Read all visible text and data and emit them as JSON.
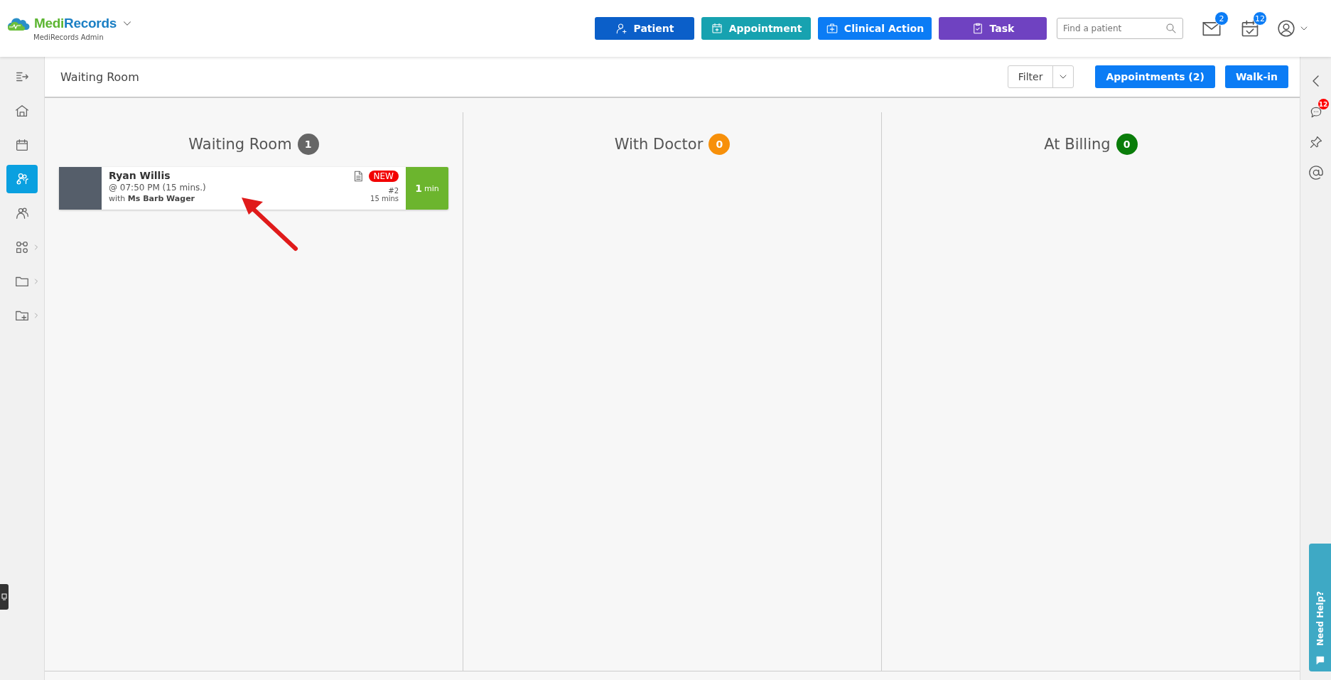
{
  "header": {
    "brand": {
      "name_part_1": "Medi",
      "name_part_2": "Records",
      "subtitle": "MediRecords Admin"
    },
    "actions": [
      {
        "label": "Patient",
        "color": "#0b5fc9"
      },
      {
        "label": "Appointment",
        "color": "#17a2b0"
      },
      {
        "label": "Clinical Action",
        "color": "#0b7cf5"
      },
      {
        "label": "Task",
        "color": "#6f42c1"
      }
    ],
    "search": {
      "placeholder": "Find a patient"
    },
    "notifications": [
      {
        "badge": "2"
      },
      {
        "badge": "12"
      }
    ]
  },
  "sidebar": {
    "items": [
      {
        "selected": false,
        "expandable": false
      },
      {
        "selected": false,
        "expandable": false
      },
      {
        "selected": false,
        "expandable": false
      },
      {
        "selected": true,
        "expandable": false
      },
      {
        "selected": false,
        "expandable": false
      },
      {
        "selected": false,
        "expandable": true
      },
      {
        "selected": false,
        "expandable": true
      },
      {
        "selected": false,
        "expandable": true
      }
    ]
  },
  "toolbar": {
    "title": "Waiting Room",
    "filter": "Filter",
    "buttons": [
      "Appointments (2)",
      "Walk-in"
    ]
  },
  "columns": [
    {
      "title": "Waiting Room",
      "count": "1",
      "color": "#666666",
      "cards": [
        {
          "name": "Ryan Willis",
          "time": "@ 07:50 PM (15 mins.)",
          "with": "with **Ms Barb Wager**",
          "badge": "NEW",
          "number": "#2",
          "duration": "15 mins",
          "wait": "**1** min"
        }
      ]
    },
    {
      "title": "With Doctor",
      "count": "0",
      "color": "#f7900a"
    },
    {
      "title": "At Billing",
      "count": "0",
      "color": "#0a7d0a"
    }
  ],
  "right_panel": {
    "chat_badge": "12",
    "help": "Need Help?"
  }
}
